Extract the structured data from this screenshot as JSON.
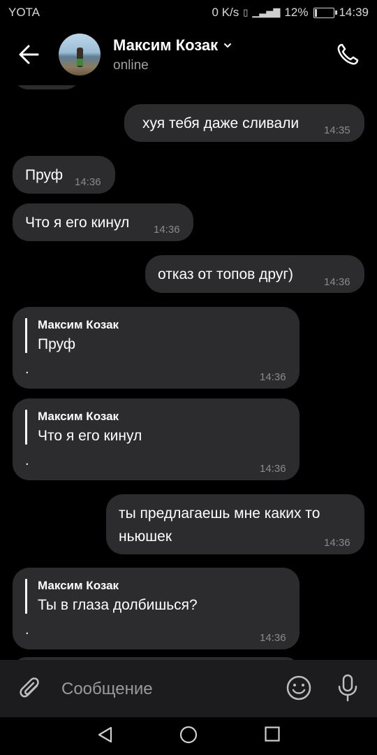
{
  "status_bar": {
    "carrier": "YOTA",
    "speed": "0 K/s",
    "battery_percent": "12%",
    "battery_level": 0.12,
    "time": "14:39"
  },
  "header": {
    "contact_name": "Максим Козак",
    "status": "online",
    "icons": {
      "back": "arrow-left-icon",
      "call": "phone-icon",
      "dropdown": "chevron-down-icon"
    }
  },
  "messages": [
    {
      "side": "out",
      "text": "хуя тебя даже сливали",
      "time": "14:35"
    },
    {
      "side": "in",
      "text": "Пруф",
      "time": "14:36"
    },
    {
      "side": "in",
      "text": "Что я его кинул",
      "time": "14:36"
    },
    {
      "side": "out",
      "text": "отказ от топов друг)",
      "time": "14:36"
    },
    {
      "side": "in",
      "reply_author": "Максим Козак",
      "reply_text": "Пруф",
      "text": ".",
      "time": "14:36"
    },
    {
      "side": "in",
      "reply_author": "Максим Козак",
      "reply_text": "Что я его кинул",
      "text": ".",
      "time": "14:36"
    },
    {
      "side": "out",
      "text_line1": "ты предлагаешь мне каких то",
      "text_line2": "ньюшек",
      "time": "14:36"
    },
    {
      "side": "in",
      "reply_author": "Максим Козак",
      "reply_text": "Ты в глаза долбишься?",
      "text": ".",
      "time": "14:36"
    }
  ],
  "composer": {
    "placeholder": "Сообщение",
    "icons": {
      "attach": "paperclip-icon",
      "emoji": "smiley-icon",
      "mic": "microphone-icon"
    }
  },
  "nav": {
    "icons": [
      "back-triangle-icon",
      "home-circle-icon",
      "recents-square-icon"
    ]
  },
  "colors": {
    "background": "#000000",
    "bubble": "#2c2c2e",
    "time": "#8a8a8e",
    "composer": "#1c1c1e"
  }
}
